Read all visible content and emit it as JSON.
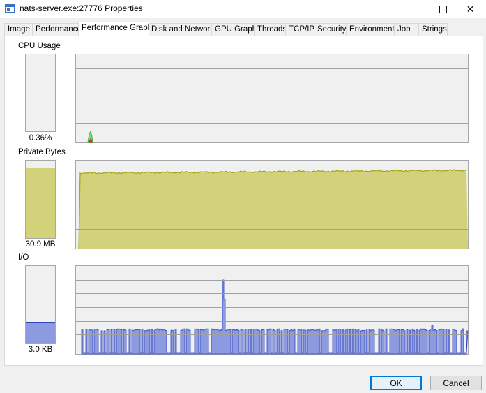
{
  "window": {
    "title": "nats-server.exe:27776 Properties"
  },
  "tabs": [
    {
      "label": "Image"
    },
    {
      "label": "Performance"
    },
    {
      "label": "Performance Graph",
      "active": true
    },
    {
      "label": "Disk and Network"
    },
    {
      "label": "GPU Graph"
    },
    {
      "label": "Threads"
    },
    {
      "label": "TCP/IP"
    },
    {
      "label": "Security"
    },
    {
      "label": "Environment"
    },
    {
      "label": "Job"
    },
    {
      "label": "Strings"
    }
  ],
  "sections": {
    "cpu": {
      "label": "CPU Usage",
      "value": "0.36%",
      "fill_fraction": 0.004,
      "color": "#2eb82e"
    },
    "private_bytes": {
      "label": "Private Bytes",
      "value": "30.9 MB",
      "fill_fraction": 0.9,
      "color": "#d2d27a",
      "line_color": "#a6a61e"
    },
    "io": {
      "label": "I/O",
      "value": "3.0  KB",
      "fill_fraction": 0.26,
      "color": "#8c9be0",
      "line_color": "#3045c0"
    }
  },
  "buttons": {
    "ok": "OK",
    "cancel": "Cancel"
  },
  "icons": {
    "app": "window-icon",
    "minimize": "minimize-icon",
    "maximize": "maximize-icon",
    "close": "close-icon"
  }
}
